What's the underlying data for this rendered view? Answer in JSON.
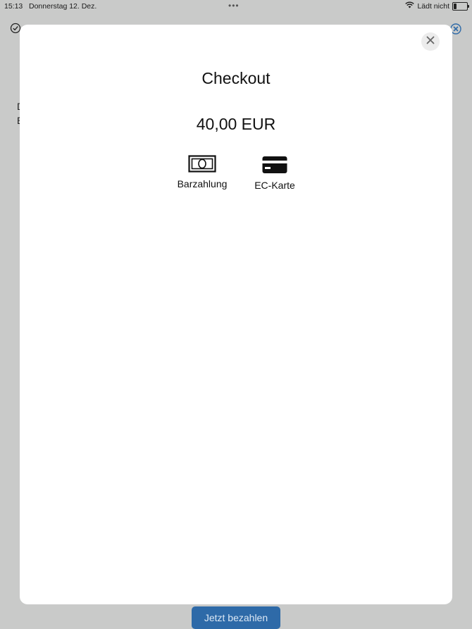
{
  "status_bar": {
    "time": "15:13",
    "date": "Donnerstag 12. Dez.",
    "dots": "•••",
    "charging_text": "Lädt nicht",
    "battery_level": 0.2
  },
  "background": {
    "text_line_1": "D",
    "text_line_2": "E",
    "pay_button_label": "Jetzt bezahlen",
    "accent_color": "#2e6aa8"
  },
  "modal": {
    "title": "Checkout",
    "amount": "40,00 EUR",
    "payment_options": [
      {
        "label": "Barzahlung",
        "icon": "cash-icon"
      },
      {
        "label": "EC-Karte",
        "icon": "credit-card-icon"
      }
    ]
  }
}
